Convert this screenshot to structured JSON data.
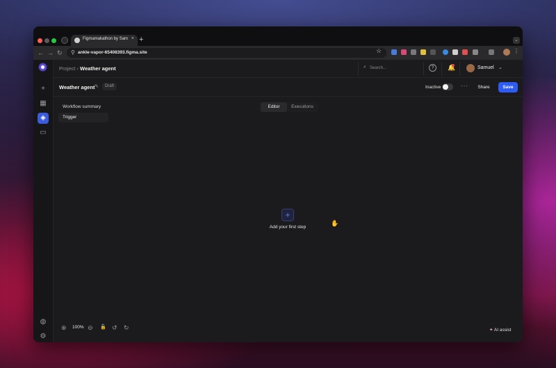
{
  "browser": {
    "tab_title": "Figmamakathon by Sam",
    "tab_close": "×",
    "new_tab": "+",
    "tab_menu": "⌄",
    "url": "ankle-vapor-65408393.figma.site",
    "back": "←",
    "forward": "→",
    "reload": "↻",
    "star": "☆",
    "menu": "⋮"
  },
  "sidebar": {
    "add": "+",
    "dashboard": "▦",
    "layers": "◈",
    "folder": "▭",
    "bug": "◍",
    "settings": "⚙"
  },
  "header": {
    "breadcrumb_parent": "Project",
    "breadcrumb_sep": "›",
    "breadcrumb_current": "Weather agent",
    "search_placeholder": "Search...",
    "help": "?",
    "bell": "🔔",
    "user_name": "Samuel",
    "user_chevron": "⌄"
  },
  "workflow": {
    "title": "Weather agent",
    "pencil": "✎",
    "status_badge": "Draft",
    "toggle_label": "Inactive",
    "more": "···",
    "share_label": "Share",
    "save_label": "Save"
  },
  "panel": {
    "items": [
      "Workflow summary",
      "Trigger"
    ]
  },
  "view_tabs": [
    "Editor",
    "Executions"
  ],
  "canvas": {
    "add_icon": "+",
    "add_label": "Add your first step",
    "cursor": "✋"
  },
  "zoom": {
    "zoom_in": "⊕",
    "value": "100%",
    "zoom_out": "⊖",
    "lock": "🔓",
    "undo": "↺",
    "redo": "↻"
  },
  "ai": {
    "icon": "✦",
    "label": "AI assist"
  },
  "colors": {
    "accent": "#2f5bf5",
    "sidebar_active": "#3b5bdb",
    "notification": "#e5484d"
  }
}
